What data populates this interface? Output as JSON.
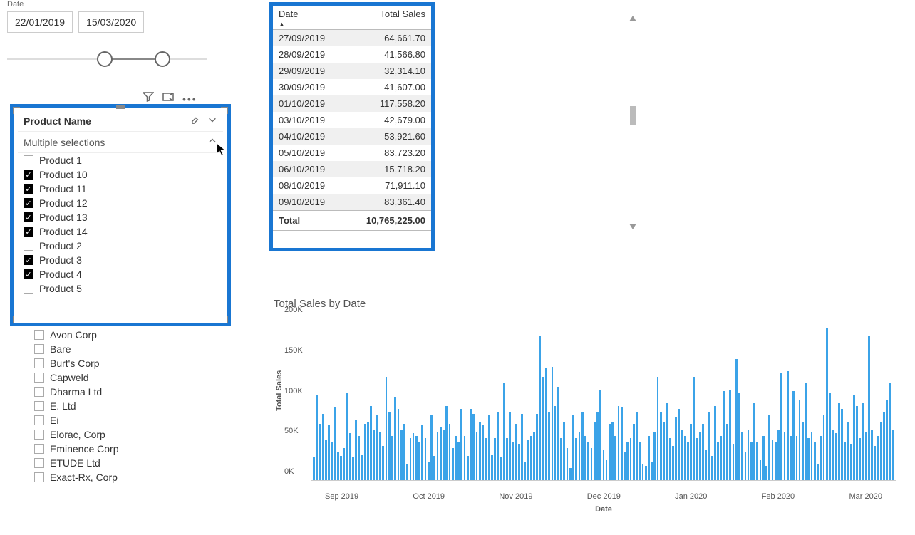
{
  "date_slicer": {
    "label": "Date",
    "from": "22/01/2019",
    "to": "15/03/2020",
    "handle1_pct": 49,
    "handle2_pct": 78
  },
  "product_slicer": {
    "title": "Product Name",
    "dropdown_text": "Multiple selections",
    "items": [
      {
        "label": "Product 1",
        "checked": false
      },
      {
        "label": "Product 10",
        "checked": true
      },
      {
        "label": "Product 11",
        "checked": true
      },
      {
        "label": "Product 12",
        "checked": true
      },
      {
        "label": "Product 13",
        "checked": true
      },
      {
        "label": "Product 14",
        "checked": true
      },
      {
        "label": "Product 2",
        "checked": false
      },
      {
        "label": "Product 3",
        "checked": true
      },
      {
        "label": "Product 4",
        "checked": true
      },
      {
        "label": "Product 5",
        "checked": false
      }
    ]
  },
  "customer_slicer": {
    "items": [
      {
        "label": "Avon Corp",
        "checked": false
      },
      {
        "label": "Bare",
        "checked": false
      },
      {
        "label": "Burt's Corp",
        "checked": false
      },
      {
        "label": "Capweld",
        "checked": false
      },
      {
        "label": "Dharma Ltd",
        "checked": false
      },
      {
        "label": "E. Ltd",
        "checked": false
      },
      {
        "label": "Ei",
        "checked": false
      },
      {
        "label": "Elorac, Corp",
        "checked": false
      },
      {
        "label": "Eminence Corp",
        "checked": false
      },
      {
        "label": "ETUDE Ltd",
        "checked": false
      },
      {
        "label": "Exact-Rx, Corp",
        "checked": false
      }
    ]
  },
  "sales_table": {
    "columns": [
      "Date",
      "Total Sales"
    ],
    "rows": [
      {
        "date": "27/09/2019",
        "value": "64,661.70"
      },
      {
        "date": "28/09/2019",
        "value": "41,566.80"
      },
      {
        "date": "29/09/2019",
        "value": "32,314.10"
      },
      {
        "date": "30/09/2019",
        "value": "41,607.00"
      },
      {
        "date": "01/10/2019",
        "value": "117,558.20"
      },
      {
        "date": "03/10/2019",
        "value": "42,679.00"
      },
      {
        "date": "04/10/2019",
        "value": "53,921.60"
      },
      {
        "date": "05/10/2019",
        "value": "83,723.20"
      },
      {
        "date": "06/10/2019",
        "value": "15,718.20"
      },
      {
        "date": "08/10/2019",
        "value": "71,911.10"
      },
      {
        "date": "09/10/2019",
        "value": "83,361.40"
      }
    ],
    "total_label": "Total",
    "total_value": "10,765,225.00"
  },
  "chart_data": {
    "type": "bar",
    "title": "Total Sales by Date",
    "xlabel": "Date",
    "ylabel": "Total Sales",
    "ylim": [
      0,
      200
    ],
    "y_ticks": [
      "0K",
      "50K",
      "100K",
      "150K",
      "200K"
    ],
    "x_ticks": [
      "Sep 2019",
      "Oct 2019",
      "Nov 2019",
      "Dec 2019",
      "Jan 2020",
      "Feb 2020",
      "Mar 2020"
    ],
    "values": [
      28,
      105,
      70,
      82,
      50,
      68,
      48,
      90,
      35,
      30,
      40,
      108,
      58,
      28,
      75,
      55,
      32,
      70,
      72,
      92,
      62,
      80,
      60,
      42,
      128,
      85,
      55,
      103,
      88,
      62,
      70,
      20,
      52,
      58,
      55,
      48,
      68,
      52,
      22,
      80,
      30,
      60,
      65,
      62,
      92,
      70,
      40,
      55,
      48,
      88,
      55,
      30,
      88,
      82,
      60,
      72,
      68,
      52,
      80,
      32,
      52,
      85,
      28,
      120,
      52,
      85,
      48,
      70,
      45,
      82,
      22,
      50,
      55,
      60,
      82,
      178,
      128,
      138,
      85,
      140,
      92,
      115,
      52,
      72,
      40,
      15,
      80,
      52,
      60,
      85,
      55,
      48,
      40,
      72,
      85,
      112,
      38,
      25,
      70,
      72,
      55,
      92,
      90,
      35,
      48,
      52,
      70,
      85,
      48,
      20,
      18,
      55,
      22,
      60,
      128,
      85,
      72,
      95,
      52,
      42,
      78,
      88,
      62,
      55,
      48,
      70,
      128,
      52,
      60,
      70,
      38,
      85,
      30,
      92,
      48,
      55,
      110,
      70,
      112,
      45,
      150,
      108,
      60,
      35,
      62,
      48,
      95,
      48,
      25,
      55,
      18,
      80,
      50,
      48,
      62,
      132,
      60,
      135,
      55,
      110,
      55,
      100,
      72,
      120,
      52,
      60,
      48,
      20,
      55,
      80,
      188,
      108,
      62,
      58,
      95,
      88,
      48,
      72,
      45,
      105,
      92,
      52,
      95,
      60,
      178,
      62,
      42,
      55,
      72,
      85,
      100,
      120,
      62
    ]
  }
}
